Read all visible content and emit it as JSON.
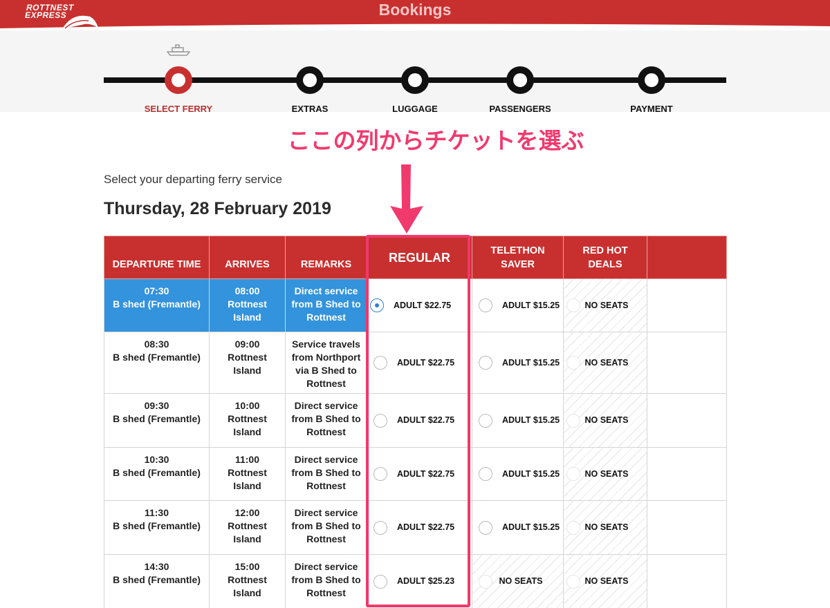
{
  "header": {
    "logo_line1": "ROTTNEST",
    "logo_line2": "EXPRESS",
    "title": "Bookings"
  },
  "steps": [
    {
      "label": "SELECT FERRY",
      "active": true
    },
    {
      "label": "EXTRAS",
      "active": false
    },
    {
      "label": "LUGGAGE",
      "active": false
    },
    {
      "label": "PASSENGERS",
      "active": false
    },
    {
      "label": "PAYMENT",
      "active": false
    }
  ],
  "annotation": "ここの列からチケットを選ぶ",
  "subtitle": "Select your departing ferry service",
  "date": "Thursday, 28 February 2019",
  "table": {
    "headers": {
      "departure": "DEPARTURE TIME",
      "arrives": "ARRIVES",
      "remarks": "REMARKS",
      "regular": "REGULAR",
      "telethon_1": "TELETHON",
      "telethon_2": "SAVER",
      "redhot_1": "RED HOT",
      "redhot_2": "DEALS"
    },
    "rows": [
      {
        "dep_time": "07:30",
        "dep_place": "B shed (Fremantle)",
        "arr_time": "08:00",
        "arr_place_1": "Rottnest",
        "arr_place_2": "Island",
        "remark_1": "Direct service",
        "remark_2": "from B Shed to",
        "remark_3": "Rottnest",
        "remark_4": "",
        "regular": "ADULT $22.75",
        "telethon": "ADULT $15.25",
        "redhot": "NO SEATS"
      },
      {
        "dep_time": "08:30",
        "dep_place": "B shed (Fremantle)",
        "arr_time": "09:00",
        "arr_place_1": "Rottnest",
        "arr_place_2": "Island",
        "remark_1": "Service travels",
        "remark_2": "from Northport",
        "remark_3": "via B Shed to",
        "remark_4": "Rottnest",
        "regular": "ADULT $22.75",
        "telethon": "ADULT $15.25",
        "redhot": "NO SEATS"
      },
      {
        "dep_time": "09:30",
        "dep_place": "B shed (Fremantle)",
        "arr_time": "10:00",
        "arr_place_1": "Rottnest",
        "arr_place_2": "Island",
        "remark_1": "Direct service",
        "remark_2": "from B Shed to",
        "remark_3": "Rottnest",
        "remark_4": "",
        "regular": "ADULT $22.75",
        "telethon": "ADULT $15.25",
        "redhot": "NO SEATS"
      },
      {
        "dep_time": "10:30",
        "dep_place": "B shed (Fremantle)",
        "arr_time": "11:00",
        "arr_place_1": "Rottnest",
        "arr_place_2": "Island",
        "remark_1": "Direct service",
        "remark_2": "from B Shed to",
        "remark_3": "Rottnest",
        "remark_4": "",
        "regular": "ADULT $22.75",
        "telethon": "ADULT $15.25",
        "redhot": "NO SEATS"
      },
      {
        "dep_time": "11:30",
        "dep_place": "B shed (Fremantle)",
        "arr_time": "12:00",
        "arr_place_1": "Rottnest",
        "arr_place_2": "Island",
        "remark_1": "Direct service",
        "remark_2": "from B Shed to",
        "remark_3": "Rottnest",
        "remark_4": "",
        "regular": "ADULT $22.75",
        "telethon": "ADULT $15.25",
        "redhot": "NO SEATS"
      },
      {
        "dep_time": "14:30",
        "dep_place": "B shed (Fremantle)",
        "arr_time": "15:00",
        "arr_place_1": "Rottnest",
        "arr_place_2": "Island",
        "remark_1": "Direct service",
        "remark_2": "from B Shed to",
        "remark_3": "Rottnest",
        "remark_4": "",
        "regular": "ADULT $25.23",
        "telethon": "NO SEATS",
        "redhot": "NO SEATS"
      }
    ]
  },
  "colors": {
    "brand_red": "#c8302f",
    "selected_blue": "#3393dc",
    "annotation_pink": "#f03a6e"
  }
}
